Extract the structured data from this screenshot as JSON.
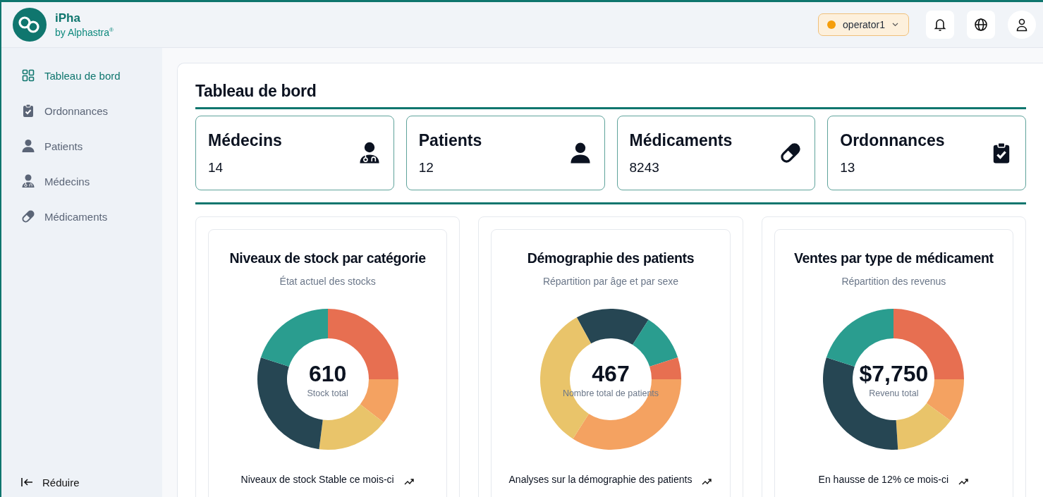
{
  "app": {
    "name": "iPha",
    "byline": "by Alphastra$^{®}$"
  },
  "user_menu": {
    "label": "operator1"
  },
  "sidebar": {
    "items": [
      {
        "label": "Tableau de bord",
        "kind": "grid",
        "selected": true
      },
      {
        "label": "Ordonnances",
        "kind": "clipboard",
        "selected": false
      },
      {
        "label": "Patients",
        "kind": "person",
        "selected": false
      },
      {
        "label": "Médecins",
        "kind": "doctor",
        "selected": false
      },
      {
        "label": "Médicaments",
        "kind": "pill",
        "selected": false
      }
    ],
    "collapse": "Réduire"
  },
  "page_title": "Tableau de bord",
  "stats": [
    {
      "label": "Médecins",
      "value": "14",
      "kind": "doctor"
    },
    {
      "label": "Patients",
      "value": "12",
      "kind": "person"
    },
    {
      "label": "Médicaments",
      "value": "8243",
      "kind": "pill"
    },
    {
      "label": "Ordonnances",
      "value": "13",
      "kind": "clipboard"
    }
  ],
  "charts": [
    {
      "title": "Niveaux de stock par catégorie",
      "subtitle": "État actuel des stocks",
      "total": "610",
      "total_label": "Stock total",
      "footer": "Niveaux de stock Stable ce mois-ci"
    },
    {
      "title": "Démographie des patients",
      "subtitle": "Répartition par âge et par sexe",
      "total": "467",
      "total_label": "Nombre total de patients",
      "footer": "Analyses sur la démographie des patients"
    },
    {
      "title": "Ventes par type de médicament",
      "subtitle": "Répartition des revenus",
      "total": "$7,750",
      "total_label": "Revenu total",
      "footer": "En hausse de 12% ce mois-ci"
    }
  ]
}
